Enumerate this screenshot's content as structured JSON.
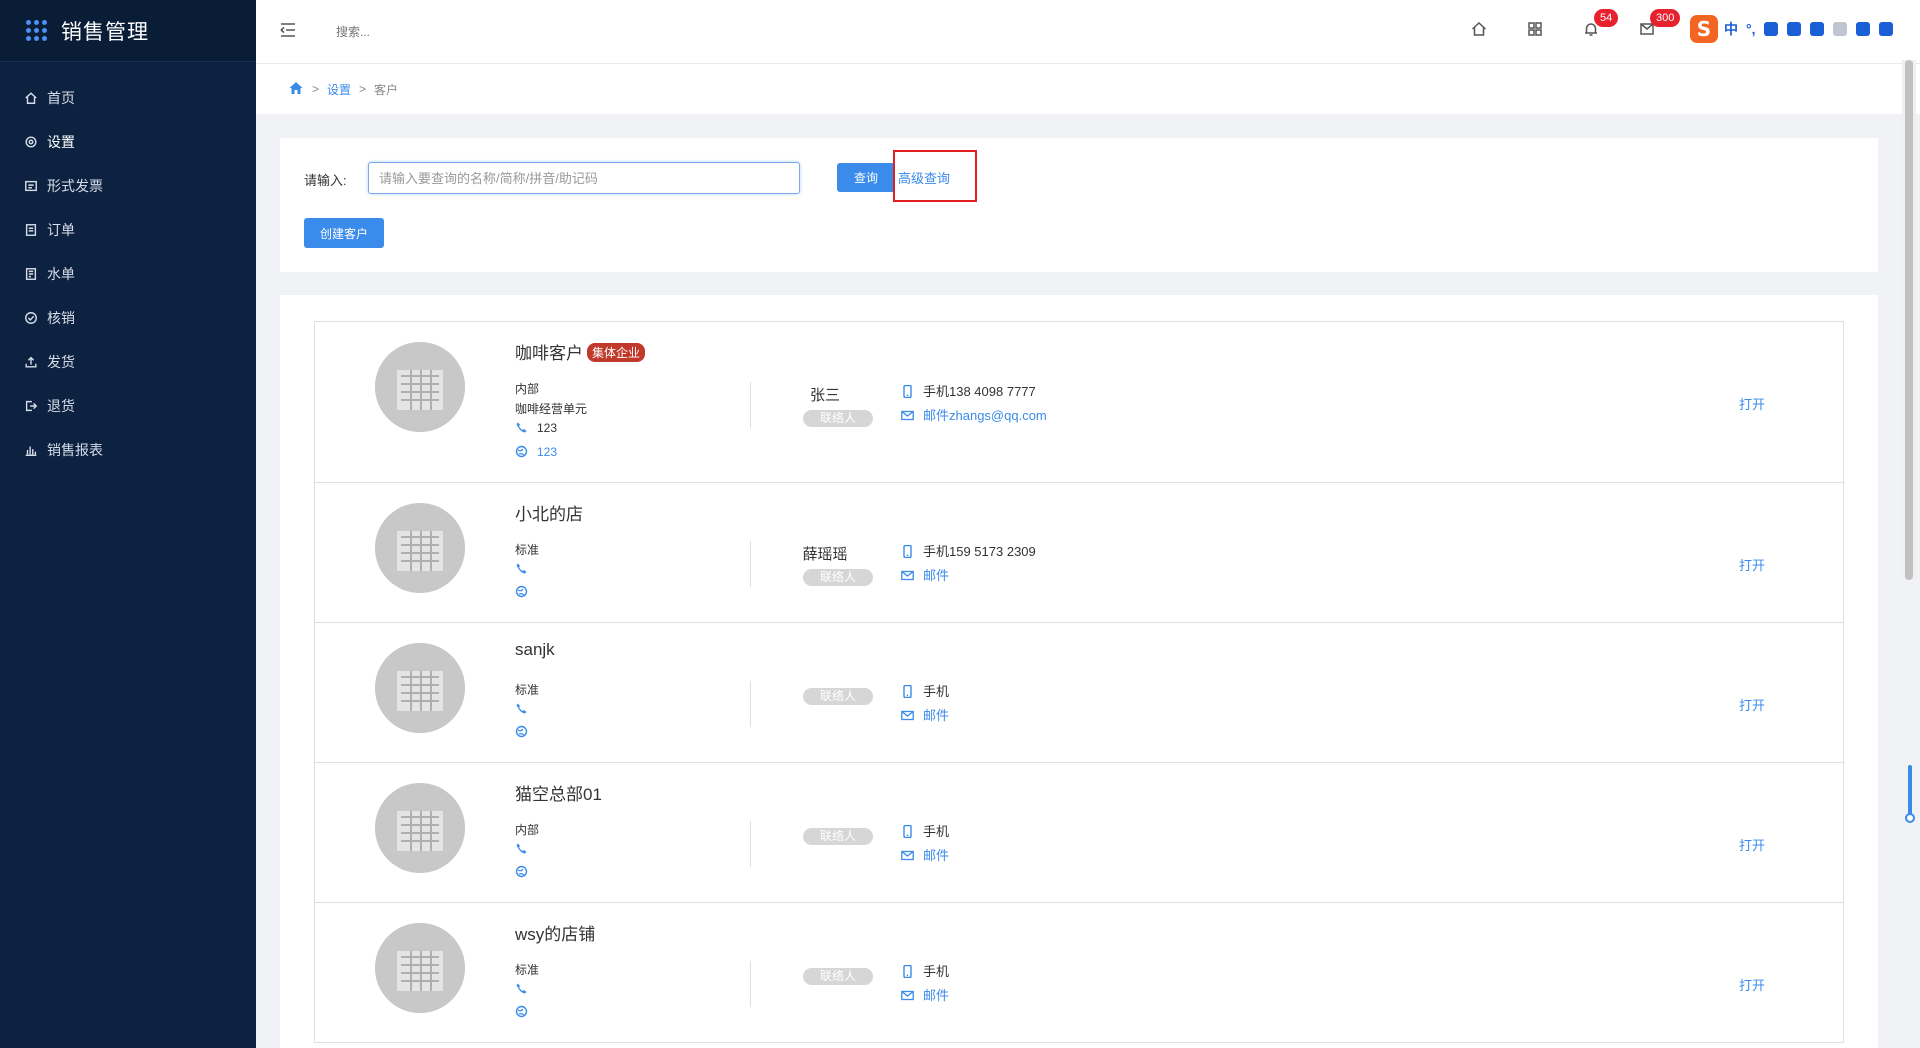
{
  "app": {
    "title": "销售管理"
  },
  "sidebar": {
    "items": [
      {
        "label": "首页",
        "icon": "home-icon"
      },
      {
        "label": "设置",
        "icon": "gear-icon"
      },
      {
        "label": "形式发票",
        "icon": "invoice-icon"
      },
      {
        "label": "订单",
        "icon": "order-icon"
      },
      {
        "label": "水单",
        "icon": "receipt-icon"
      },
      {
        "label": "核销",
        "icon": "check-circle-icon"
      },
      {
        "label": "发货",
        "icon": "upload-icon"
      },
      {
        "label": "退货",
        "icon": "return-icon"
      },
      {
        "label": "销售报表",
        "icon": "bar-chart-icon"
      }
    ],
    "active": "设置"
  },
  "topbar": {
    "search_placeholder": "搜索...",
    "notifications_count": "54",
    "messages_count": "300",
    "ime_chars": [
      "中",
      "°,"
    ]
  },
  "breadcrumb": {
    "items": [
      "设置",
      "客户"
    ]
  },
  "search": {
    "label": "请输入:",
    "placeholder": "请输入要查询的名称/简称/拼音/助记码",
    "query_button": "查询",
    "advanced_link": "高级查询",
    "create_button": "创建客户"
  },
  "customers": [
    {
      "name": "咖啡客户",
      "tag": "集体企业",
      "type": "内部",
      "unit": "咖啡经营单元",
      "phone": "123",
      "web": "123",
      "contact_name": "张三",
      "contact_badge": "联络人",
      "mobile": "手机138 4098 7777",
      "email": "邮件zhangs@qq.com",
      "action": "打开"
    },
    {
      "name": "小北的店",
      "tag": "",
      "type": "标准",
      "unit": "",
      "phone": "",
      "web": "",
      "contact_name": "薛瑶瑶",
      "contact_badge": "联络人",
      "mobile": "手机159 5173 2309",
      "email": "邮件",
      "action": "打开"
    },
    {
      "name": "sanjk",
      "tag": "",
      "type": "标准",
      "unit": "",
      "phone": "",
      "web": "",
      "contact_name": "",
      "contact_badge": "联络人",
      "mobile": "手机",
      "email": "邮件",
      "action": "打开"
    },
    {
      "name": "猫空总部01",
      "tag": "",
      "type": "内部",
      "unit": "",
      "phone": "",
      "web": "",
      "contact_name": "",
      "contact_badge": "联络人",
      "mobile": "手机",
      "email": "邮件",
      "action": "打开"
    },
    {
      "name": "wsy的店铺",
      "tag": "",
      "type": "标准",
      "unit": "",
      "phone": "",
      "web": "",
      "contact_name": "",
      "contact_badge": "联络人",
      "mobile": "手机",
      "email": "邮件",
      "action": "打开"
    }
  ],
  "colors": {
    "sidebar_bg": "#0d2240",
    "accent": "#3b8bea",
    "tag": "#c0392b",
    "badge": "#e8212e"
  }
}
